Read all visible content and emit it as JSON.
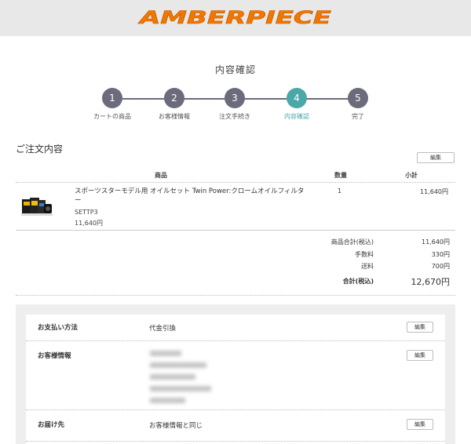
{
  "brand": {
    "logo_text": "AMBERPIECE",
    "accent": "#f07800"
  },
  "page_title": "内容確認",
  "steps": [
    {
      "num": "1",
      "label": "カートの商品"
    },
    {
      "num": "2",
      "label": "お客様情報"
    },
    {
      "num": "3",
      "label": "注文手続き"
    },
    {
      "num": "4",
      "label": "内容確認"
    },
    {
      "num": "5",
      "label": "完了"
    }
  ],
  "order": {
    "title": "ご注文内容",
    "edit_label": "編集",
    "columns": {
      "product": "商品",
      "qty": "数量",
      "subtotal": "小計"
    },
    "items": [
      {
        "name": "スポーツスターモデル用 オイルセット Twin Power:クロームオイルフィルター",
        "code": "SETTP3",
        "price": "11,640円",
        "qty": "1",
        "subtotal": "11,640円"
      }
    ],
    "summary": {
      "goods_label": "商品合計(税込)",
      "goods_value": "11,640円",
      "fee_label": "手数料",
      "fee_value": "330円",
      "shipping_label": "送料",
      "shipping_value": "700円",
      "total_label": "合計(税込)",
      "total_value": "12,670円"
    }
  },
  "details": {
    "edit_label": "編集",
    "payment_label": "お支払い方法",
    "payment_value": "代金引換",
    "customer_label": "お客様情報",
    "delivery_label": "お届け先",
    "delivery_value": "お客様情報と同じ"
  }
}
